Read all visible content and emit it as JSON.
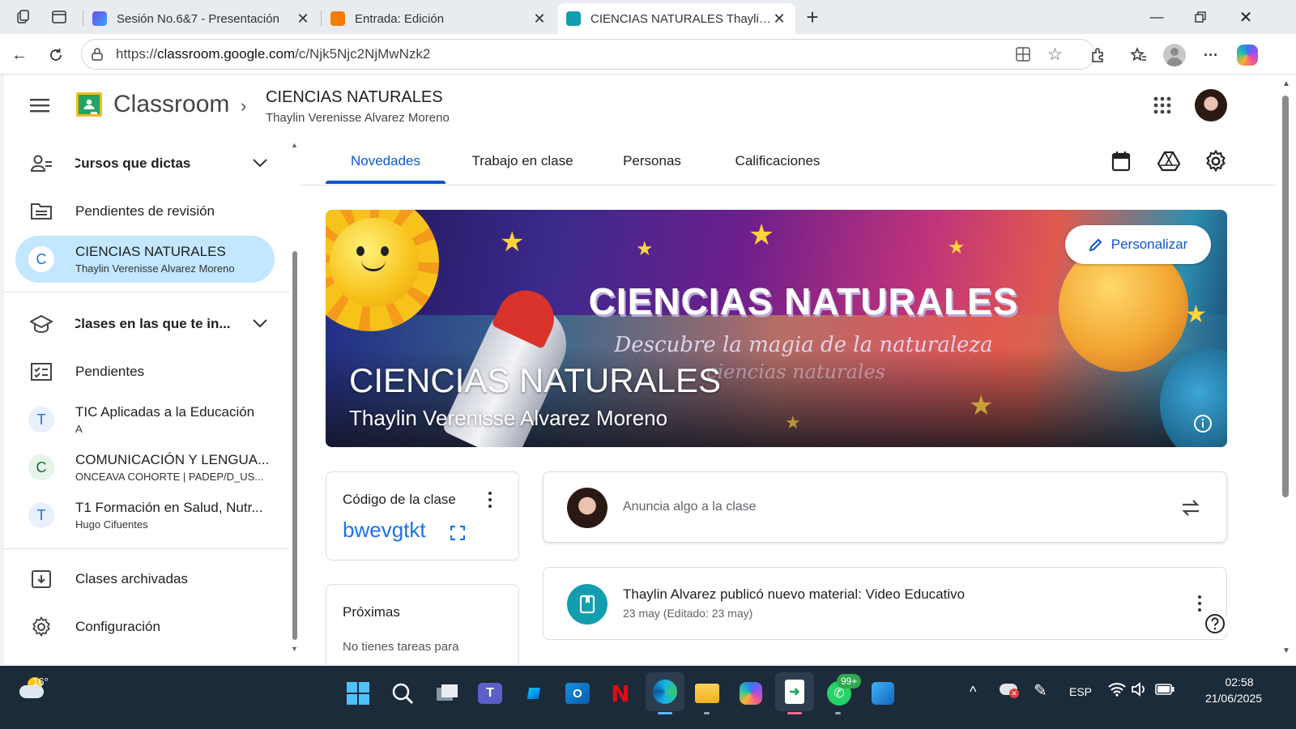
{
  "browser": {
    "tabs": [
      {
        "title": "Sesión No.6&7 - Presentación"
      },
      {
        "title": "Entrada: Edición"
      },
      {
        "title": "CIENCIAS NATURALES Thaylin Verenisse Alvarez Moreno"
      }
    ],
    "url_prefix": "https://",
    "url_domain": "classroom.google.com",
    "url_path": "/c/Njk5Njc2NjMwNzk2"
  },
  "header": {
    "app_name": "Classroom",
    "breadcrumb_title": "CIENCIAS NATURALES",
    "breadcrumb_subtitle": "Thaylin Verenisse Alvarez Moreno"
  },
  "sidebar": {
    "teaching_label": "Cursos que dictas",
    "review_label": "Pendientes de revisión",
    "current_class": {
      "letter": "C",
      "name": "CIENCIAS NATURALES",
      "sub": "Thaylin Verenisse Alvarez Moreno"
    },
    "enrolled_label": "Clases en las que te in...",
    "todo_label": "Pendientes",
    "classes": [
      {
        "letter": "T",
        "name": "TIC Aplicadas a la Educación",
        "sub": "A"
      },
      {
        "letter": "C",
        "name": "COMUNICACIÓN Y LENGUA...",
        "sub": "ONCEAVA COHORTE | PADEP/D_US..."
      },
      {
        "letter": "T",
        "name": "T1 Formación en Salud, Nutr...",
        "sub": "Hugo Cifuentes"
      }
    ],
    "archived_label": "Clases archivadas",
    "settings_label": "Configuración"
  },
  "tabs": [
    "Novedades",
    "Trabajo en clase",
    "Personas",
    "Calificaciones"
  ],
  "banner": {
    "art_title": "CIENCIAS NATURALES",
    "art_subtitle": "Descubre la magia de la naturaleza",
    "art_subtitle2": "ciencias naturales",
    "title": "CIENCIAS NATURALES",
    "teacher": "Thaylin Verenisse Alvarez Moreno",
    "customize_label": "Personalizar"
  },
  "class_code": {
    "label": "Código de la clase",
    "code": "bwevgtkt"
  },
  "upcoming": {
    "label": "Próximas",
    "text": "No tienes tareas para"
  },
  "announce": {
    "placeholder": "Anuncia algo a la clase"
  },
  "post": {
    "title": "Thaylin Alvarez publicó nuevo material: Video Educativo",
    "date": "23 may (Editado: 23 may)"
  },
  "taskbar": {
    "temperature": "16°",
    "badge": "99+",
    "lang": "ESP",
    "time": "02:58",
    "date": "21/06/2025"
  },
  "colors": {
    "accent": "#0b57d0",
    "selected_bg": "#c2e7ff",
    "code": "#1a73e8",
    "post_icon": "#129eaf"
  }
}
